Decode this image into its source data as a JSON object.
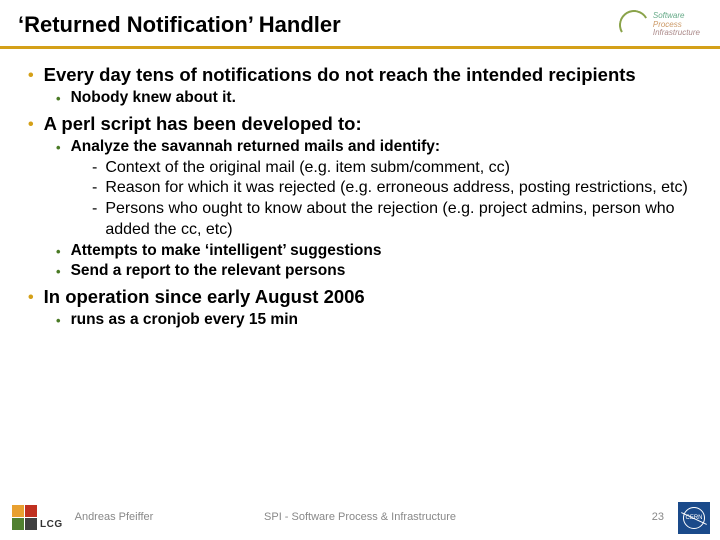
{
  "header": {
    "title": "‘Returned Notification’ Handler",
    "spi_label_1": "Software",
    "spi_label_2": "Process",
    "spi_label_3": "Infrastructure"
  },
  "bullets": [
    {
      "text": "Every day tens of notifications do not reach the intended recipients",
      "sub": [
        {
          "text": "Nobody knew about it."
        }
      ]
    },
    {
      "text": "A perl script has been developed to:",
      "sub": [
        {
          "text": "Analyze the savannah returned mails and identify:",
          "sub3": [
            "Context of the original mail (e.g. item subm/comment, cc)",
            "Reason for which it was rejected (e.g. erroneous address, posting restrictions, etc)",
            "Persons who ought to know about the rejection (e.g. project admins, person who added the cc, etc)"
          ]
        },
        {
          "text": "Attempts to make ‘intelligent’ suggestions"
        },
        {
          "text": "Send a report to the relevant persons"
        }
      ]
    },
    {
      "text": "In operation since early August 2006",
      "sub": [
        {
          "text": "runs as a cronjob every 15 min"
        }
      ]
    }
  ],
  "footer": {
    "lcg": "LCG",
    "author": "Andreas Pfeiffer",
    "center": "SPI - Software Process & Infrastructure",
    "page": "23",
    "cern": "CERN"
  }
}
